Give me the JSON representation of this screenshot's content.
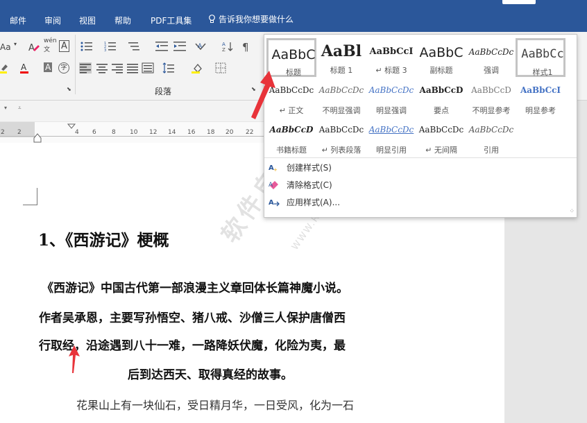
{
  "tabs": [
    "邮件",
    "审阅",
    "视图",
    "帮助",
    "PDF工具集"
  ],
  "tell_me": "告诉我你想要做什么",
  "ribbon": {
    "font_size_label": "Aa",
    "wen_label": "wén",
    "wen_char": "文",
    "a_label": "A",
    "paragraph_group": "段落"
  },
  "ruler_ticks": [
    "2",
    "2",
    "4",
    "6",
    "8",
    "10",
    "12",
    "14",
    "16",
    "18",
    "20",
    "22"
  ],
  "gallery": {
    "row1": [
      {
        "sample": "AaBbC",
        "label": "标题"
      },
      {
        "sample": "AaBl",
        "label": "标题 1"
      },
      {
        "sample": "AaBbCcI",
        "label": "↵ 标题 3"
      },
      {
        "sample": "AaBbC",
        "label": "副标题"
      },
      {
        "sample": "AaBbCcDc",
        "label": "强调"
      },
      {
        "sample": "AaBbCc",
        "label": "样式1"
      }
    ],
    "row2": [
      {
        "sample": "AaBbCcDc",
        "label": "↵ 正文"
      },
      {
        "sample": "AaBbCcDc",
        "label": "不明显强调"
      },
      {
        "sample": "AaBbCcDc",
        "label": "明显强调"
      },
      {
        "sample": "AaBbCcD",
        "label": "要点"
      },
      {
        "sample": "AaBbCcD",
        "label": "不明显参考"
      },
      {
        "sample": "AaBbCcI",
        "label": "明显参考"
      }
    ],
    "row3": [
      {
        "sample": "AaBbCcD",
        "label": "书籍标题"
      },
      {
        "sample": "AaBbCcDc",
        "label": "↵ 列表段落"
      },
      {
        "sample": "AaBbCcDc",
        "label": "明显引用"
      },
      {
        "sample": "AaBbCcDc",
        "label": "↵ 无间隔"
      },
      {
        "sample": "AaBbCcDc",
        "label": "引用"
      }
    ],
    "menu": [
      "创建样式(S)",
      "清除格式(C)",
      "应用样式(A)..."
    ]
  },
  "document": {
    "heading": "1、《西游记》梗概",
    "para_lines": [
      "《西游记》中国古代第一部浪漫主义章回体长篇神魔小说。",
      "作者吴承恩，主要写孙悟空、猪八戒、沙僧三人保护唐僧西",
      "行取经，沿途遇到八十一难，一路降妖伏魔，化险为夷，最",
      "后到达西天、取得真经的故事。"
    ],
    "next_line": "花果山上有一块仙石，受日精月华，一日受风，化为一石"
  },
  "watermark": "软件自学网",
  "watermark_url": "WWW.RJZXW.COM",
  "colors": {
    "ribbon_blue": "#2b579a",
    "arrow_red": "#e8333a"
  }
}
